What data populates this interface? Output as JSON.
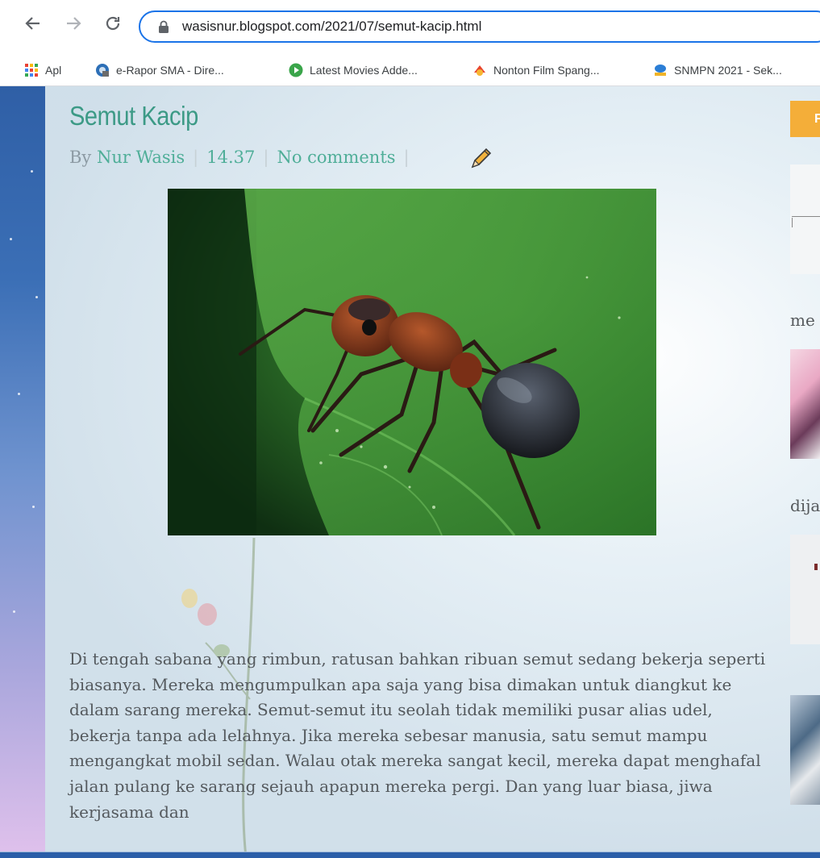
{
  "browser": {
    "url": "wasisnur.blogspot.com/2021/07/semut-kacip.html",
    "bookmarks": [
      {
        "label": "Apl",
        "icon": "apps-grid-icon"
      },
      {
        "label": "e-Rapor SMA - Dire...",
        "icon": "erapor-logo-icon"
      },
      {
        "label": "Latest Movies Adde...",
        "icon": "play-circle-icon"
      },
      {
        "label": "Nonton Film Spang...",
        "icon": "film-logo-icon"
      },
      {
        "label": "SNMPN 2021 - Sek...",
        "icon": "snmpn-logo-icon"
      }
    ]
  },
  "post": {
    "title": "Semut Kacip",
    "by_label": "By",
    "author": "Nur Wasis",
    "time": "14.37",
    "comments": "No comments",
    "separator": "|",
    "body": "Di tengah sabana yang rimbun, ratusan bahkan ribuan semut sedang bekerja seperti biasanya. Mereka mengumpulkan apa saja yang bisa dimakan untuk diangkut ke dalam sarang mereka. Semut-semut itu seolah tidak memiliki pusar alias udel, bekerja tanpa ada lelahnya. Jika mereka sebesar manusia, satu semut mampu mengangkat mobil sedan. Walau otak mereka sangat kecil, mereka dapat menghafal jalan pulang ke sarang sejauh apapun mereka pergi. Dan yang luar biasa, jiwa kerjasama dan"
  },
  "sidebar": {
    "button_label": "F",
    "text_1": "me",
    "text_2": "dija"
  }
}
